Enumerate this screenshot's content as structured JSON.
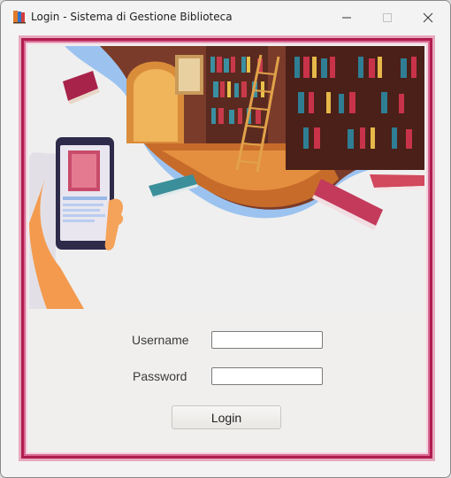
{
  "window": {
    "title": "Login - Sistema di Gestione Biblioteca",
    "controls": [
      "minimize-icon",
      "maximize-icon",
      "close-icon"
    ]
  },
  "hero": {
    "illustration": "library-reading-illustration",
    "icons": [
      "smartphone-icon",
      "book-icon"
    ]
  },
  "form": {
    "username_label": "Username",
    "password_label": "Password",
    "username_value": "",
    "password_value": "",
    "login_label": "Login"
  },
  "colors": {
    "frame_border": "#b01c4e",
    "hero_blue": "#9cc3f0",
    "background": "#f0efee"
  }
}
